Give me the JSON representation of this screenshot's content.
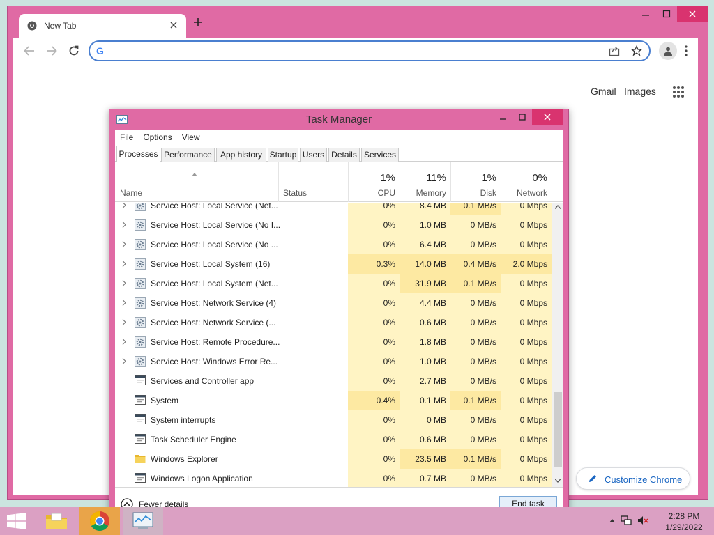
{
  "browser": {
    "tab_title": "New Tab",
    "omnibox_value": "",
    "links": {
      "gmail": "Gmail",
      "images": "Images"
    },
    "customize_label": "Customize Chrome"
  },
  "task_manager": {
    "title": "Task Manager",
    "menu": [
      "File",
      "Options",
      "View"
    ],
    "tabs": [
      "Processes",
      "Performance",
      "App history",
      "Startup",
      "Users",
      "Details",
      "Services"
    ],
    "active_tab": "Processes",
    "columns": {
      "name": "Name",
      "status": "Status",
      "cpu": {
        "percent": "1%",
        "label": "CPU"
      },
      "memory": {
        "percent": "11%",
        "label": "Memory"
      },
      "disk": {
        "percent": "1%",
        "label": "Disk"
      },
      "network": {
        "percent": "0%",
        "label": "Network"
      }
    },
    "rows": [
      {
        "name": "Service Host: Local Service (Net...",
        "expandable": true,
        "icon": "gear-icon",
        "cpu": "0%",
        "memory": "8.4 MB",
        "disk": "0.1 MB/s",
        "network": "0 Mbps"
      },
      {
        "name": "Service Host: Local Service (No I...",
        "expandable": true,
        "icon": "gear-icon",
        "cpu": "0%",
        "memory": "1.0 MB",
        "disk": "0 MB/s",
        "network": "0 Mbps"
      },
      {
        "name": "Service Host: Local Service (No ...",
        "expandable": true,
        "icon": "gear-icon",
        "cpu": "0%",
        "memory": "6.4 MB",
        "disk": "0 MB/s",
        "network": "0 Mbps"
      },
      {
        "name": "Service Host: Local System (16)",
        "expandable": true,
        "icon": "gear-icon",
        "cpu": "0.3%",
        "memory": "14.0 MB",
        "disk": "0.4 MB/s",
        "network": "2.0 Mbps"
      },
      {
        "name": "Service Host: Local System (Net...",
        "expandable": true,
        "icon": "gear-icon",
        "cpu": "0%",
        "memory": "31.9 MB",
        "disk": "0.1 MB/s",
        "network": "0 Mbps"
      },
      {
        "name": "Service Host: Network Service (4)",
        "expandable": true,
        "icon": "gear-icon",
        "cpu": "0%",
        "memory": "4.4 MB",
        "disk": "0 MB/s",
        "network": "0 Mbps"
      },
      {
        "name": "Service Host: Network Service (...",
        "expandable": true,
        "icon": "gear-icon",
        "cpu": "0%",
        "memory": "0.6 MB",
        "disk": "0 MB/s",
        "network": "0 Mbps"
      },
      {
        "name": "Service Host: Remote Procedure...",
        "expandable": true,
        "icon": "gear-icon",
        "cpu": "0%",
        "memory": "1.8 MB",
        "disk": "0 MB/s",
        "network": "0 Mbps"
      },
      {
        "name": "Service Host: Windows Error Re...",
        "expandable": true,
        "icon": "gear-icon",
        "cpu": "0%",
        "memory": "1.0 MB",
        "disk": "0 MB/s",
        "network": "0 Mbps"
      },
      {
        "name": "Services and Controller app",
        "expandable": false,
        "icon": "app-window-icon",
        "cpu": "0%",
        "memory": "2.7 MB",
        "disk": "0 MB/s",
        "network": "0 Mbps"
      },
      {
        "name": "System",
        "expandable": false,
        "icon": "app-window-icon",
        "cpu": "0.4%",
        "memory": "0.1 MB",
        "disk": "0.1 MB/s",
        "network": "0 Mbps"
      },
      {
        "name": "System interrupts",
        "expandable": false,
        "icon": "app-window-icon",
        "cpu": "0%",
        "memory": "0 MB",
        "disk": "0 MB/s",
        "network": "0 Mbps"
      },
      {
        "name": "Task Scheduler Engine",
        "expandable": false,
        "icon": "app-window-icon",
        "cpu": "0%",
        "memory": "0.6 MB",
        "disk": "0 MB/s",
        "network": "0 Mbps"
      },
      {
        "name": "Windows Explorer",
        "expandable": false,
        "icon": "folder-icon",
        "cpu": "0%",
        "memory": "23.5 MB",
        "disk": "0.1 MB/s",
        "network": "0 Mbps"
      },
      {
        "name": "Windows Logon Application",
        "expandable": false,
        "icon": "app-window-icon",
        "cpu": "0%",
        "memory": "0.7 MB",
        "disk": "0 MB/s",
        "network": "0 Mbps"
      }
    ],
    "fewer_details": "Fewer details",
    "end_task": "End task"
  },
  "taskbar": {
    "apps": [
      "file-explorer-icon",
      "chrome-icon",
      "task-manager-icon"
    ],
    "time": "2:28 PM",
    "date": "1/29/2022"
  },
  "colors": {
    "window_frame": "#e06aa4",
    "close_button": "#d9336f",
    "heat_light": "#fff4c4",
    "heat_mid": "#fde9a2",
    "taskbar": "#dba0c3",
    "accent_blue": "#1a66c2"
  }
}
